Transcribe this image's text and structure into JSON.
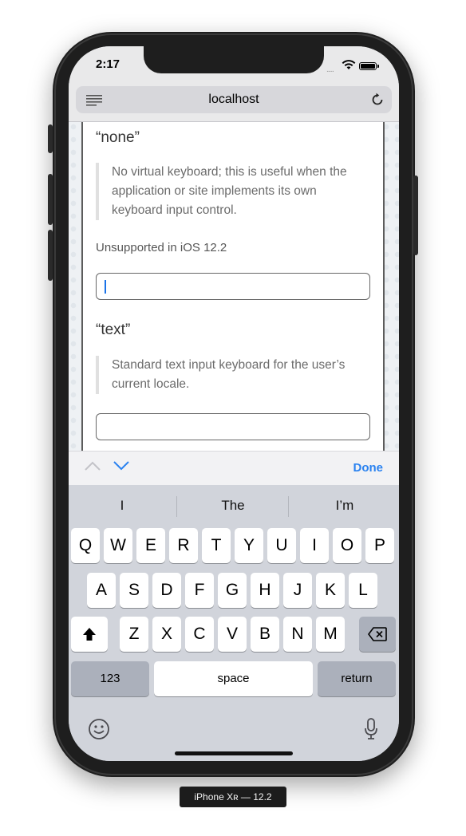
{
  "status_bar": {
    "time": "2:17",
    "signal": "....."
  },
  "browser": {
    "url": "localhost"
  },
  "sections": [
    {
      "heading": "“none”",
      "description": "No virtual keyboard; this is useful when the application or site implements its own keyboard input control.",
      "note": "Unsupported in iOS 12.2"
    },
    {
      "heading": "“text”",
      "description": "Standard text input keyboard for the user’s current locale."
    }
  ],
  "accessory_bar": {
    "done_label": "Done"
  },
  "keyboard": {
    "predictions": [
      "I",
      "The",
      "I’m"
    ],
    "row1": [
      "Q",
      "W",
      "E",
      "R",
      "T",
      "Y",
      "U",
      "I",
      "O",
      "P"
    ],
    "row2": [
      "A",
      "S",
      "D",
      "F",
      "G",
      "H",
      "J",
      "K",
      "L"
    ],
    "row3": [
      "Z",
      "X",
      "C",
      "V",
      "B",
      "N",
      "M"
    ],
    "numbers_label": "123",
    "space_label": "space",
    "return_label": "return"
  },
  "caption": "iPhone Xʀ — 12.2",
  "colors": {
    "accent": "#2a82f0",
    "caret": "#1a73e8",
    "keyboard_bg": "#d1d4db"
  }
}
